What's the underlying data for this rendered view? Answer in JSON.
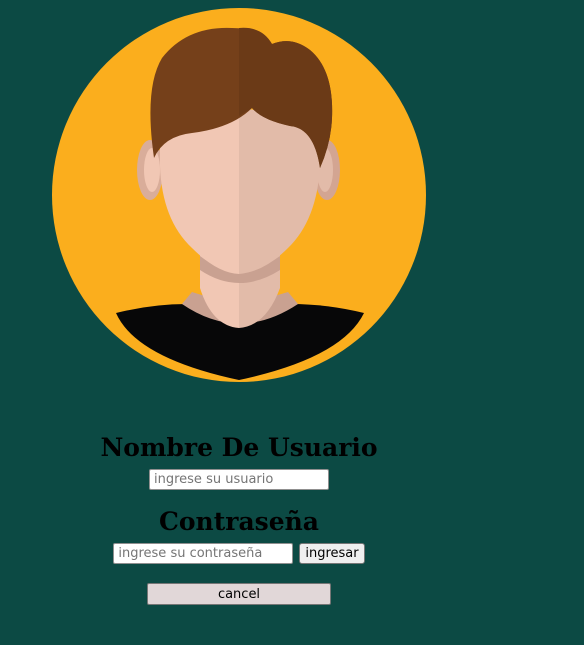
{
  "avatar": {
    "icon": "user-avatar-illustration",
    "colors": {
      "circle": "#fbae1d",
      "hair": "#75401a",
      "hair_shade": "#6b3a17",
      "skin": "#f1c7b4",
      "skin_shade": "#e2bba9",
      "neck_shadow": "#c9a191",
      "shirt": "#070708"
    }
  },
  "login": {
    "username_heading": "Nombre De Usuario",
    "username_placeholder": "ingrese su usuario",
    "password_heading": "Contraseña",
    "password_placeholder": "ingrese su contraseña",
    "submit_label": "ingresar",
    "cancel_label": "cancel"
  },
  "theme": {
    "background": "#0c4a44",
    "heading_color": "#000000",
    "cancel_button_bg": "#e1d7d8"
  }
}
